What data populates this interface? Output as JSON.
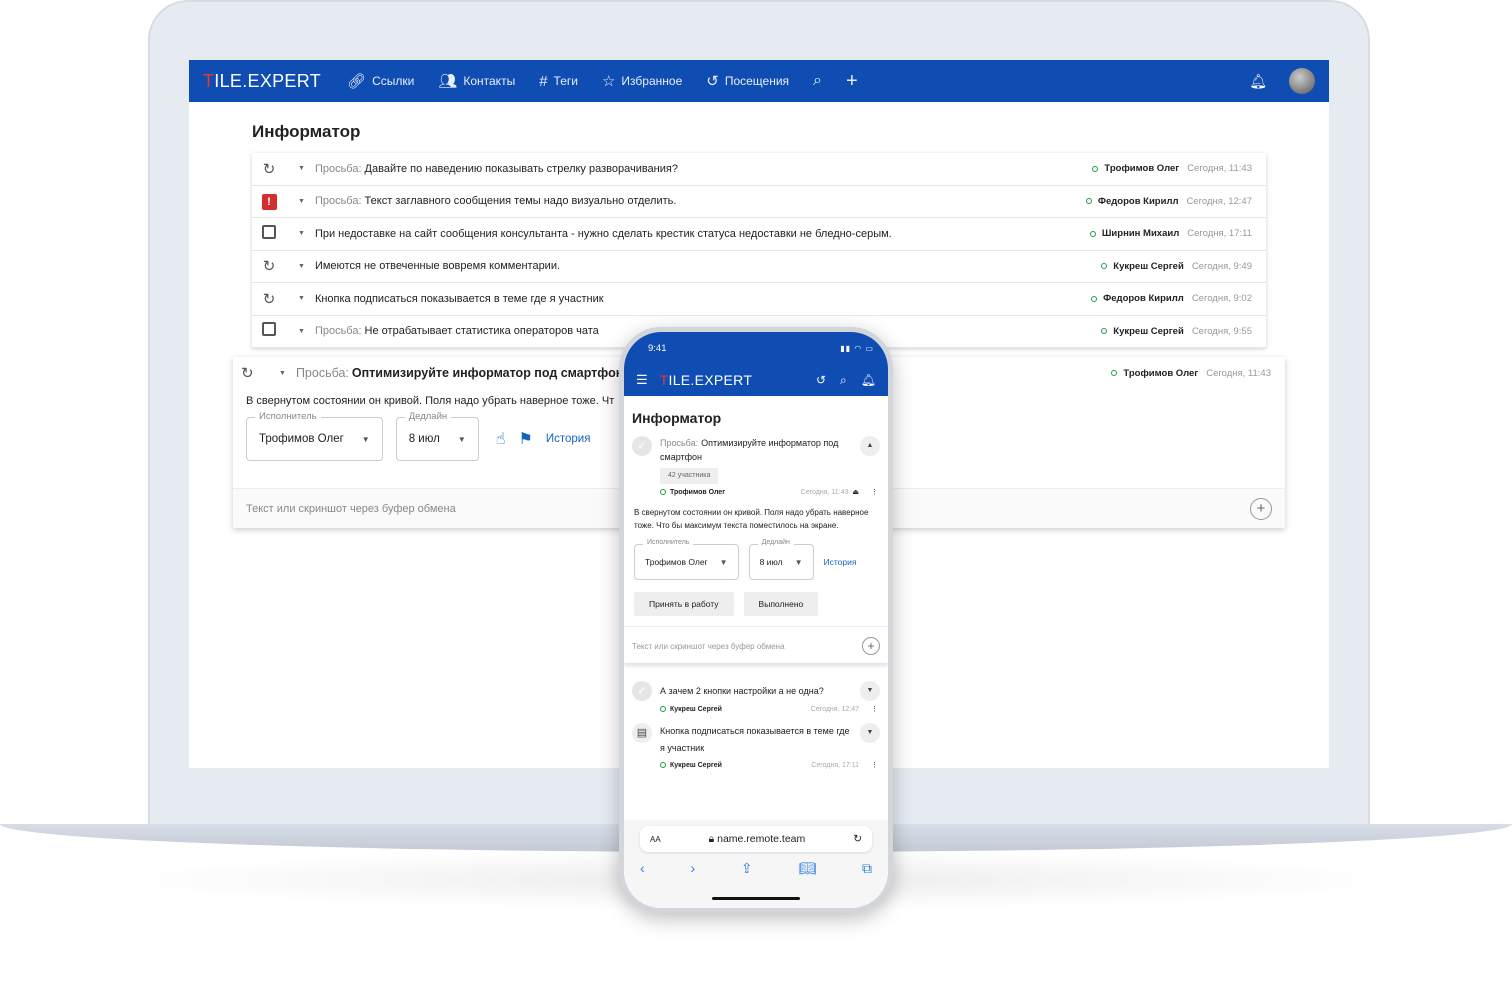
{
  "header": {
    "logo": "TILE.EXPERT",
    "nav": [
      {
        "icon": "link-icon",
        "label": "Ссылки"
      },
      {
        "icon": "contacts-icon",
        "label": "Контакты"
      },
      {
        "icon": "hash-icon",
        "label": "Теги"
      },
      {
        "icon": "star-icon",
        "label": "Избранное"
      },
      {
        "icon": "history-icon",
        "label": "Посещения"
      }
    ]
  },
  "page_title": "Информатор",
  "rows": [
    {
      "status": "clock",
      "prefix": "Просьба:",
      "text": "Давайте по наведению показывать стрелку разворачивания?",
      "author": "Трофимов Олег",
      "time": "Сегодня, 11:43"
    },
    {
      "status": "alert",
      "prefix": "Просьба:",
      "text": "Текст заглавного сообщения темы надо визуально отделить.",
      "author": "Федоров Кирилл",
      "time": "Сегодня, 12:47"
    },
    {
      "status": "checkbox",
      "prefix": "",
      "text": "При недоставке на сайт сообщения консультанта - нужно сделать крестик статуса недоставки не бледно-серым.",
      "author": "Ширнин Михаил",
      "time": "Сегодня, 17:11"
    },
    {
      "status": "clock",
      "prefix": "",
      "text": "Имеются не отвеченные вовремя комментарии.",
      "author": "Кукреш Сергей",
      "time": "Сегодня, 9:49"
    },
    {
      "status": "clock",
      "prefix": "",
      "text": "Кнопка подписаться показывается в теме где я участник",
      "author": "Федоров Кирилл",
      "time": "Сегодня, 9:02"
    },
    {
      "status": "checkbox",
      "prefix": "Просьба:",
      "text": "Не отрабатывает статистика операторов чата",
      "author": "Кукреш Сергей",
      "time": "Сегодня, 9:55"
    }
  ],
  "expanded": {
    "prefix": "Просьба:",
    "title": "Оптимизируйте информатор под смартфон",
    "author": "Трофимов Олег",
    "time": "Сегодня, 11:43",
    "body": "В свернутом состоянии он кривой. Поля надо убрать наверное тоже. Чт",
    "assignee_label": "Исполнитель",
    "assignee": "Трофимов Олег",
    "deadline_label": "Дедлайн",
    "deadline": "8 июл",
    "history": "История",
    "input_placeholder": "Текст или скриншот через буфер обмена"
  },
  "phone": {
    "time": "9:41",
    "logo": "TILE.EXPERT",
    "title": "Информатор",
    "item": {
      "prefix": "Просьба:",
      "title": "Оптимизируйте информатор под смартфон",
      "participants": "42 участника",
      "author": "Трофимов Олег",
      "time": "Сегодня, 11:43",
      "body": "В свернутом состоянии он кривой. Поля надо убрать наверное тоже. Что бы максимум текста поместилось на экране.",
      "assignee_label": "Исполнитель",
      "assignee": "Трофимов Олег",
      "deadline_label": "Дедлайн",
      "deadline": "8 июл",
      "history": "История",
      "accept": "Принять в работу",
      "done": "Выполнено",
      "input_placeholder": "Текст или скриншот через буфер обмена"
    },
    "others": [
      {
        "text": "А зачем 2 кнопки настройки а не одна?",
        "author": "Кукреш Сергей",
        "time": "Сегодня, 12:47"
      },
      {
        "text": "Кнопка подписаться показывается в теме где я участник",
        "author": "Кукреш Сергей",
        "time": "Сегодня, 17:11"
      }
    ],
    "browser": {
      "aa": "AA",
      "url": "name.remote.team"
    }
  }
}
